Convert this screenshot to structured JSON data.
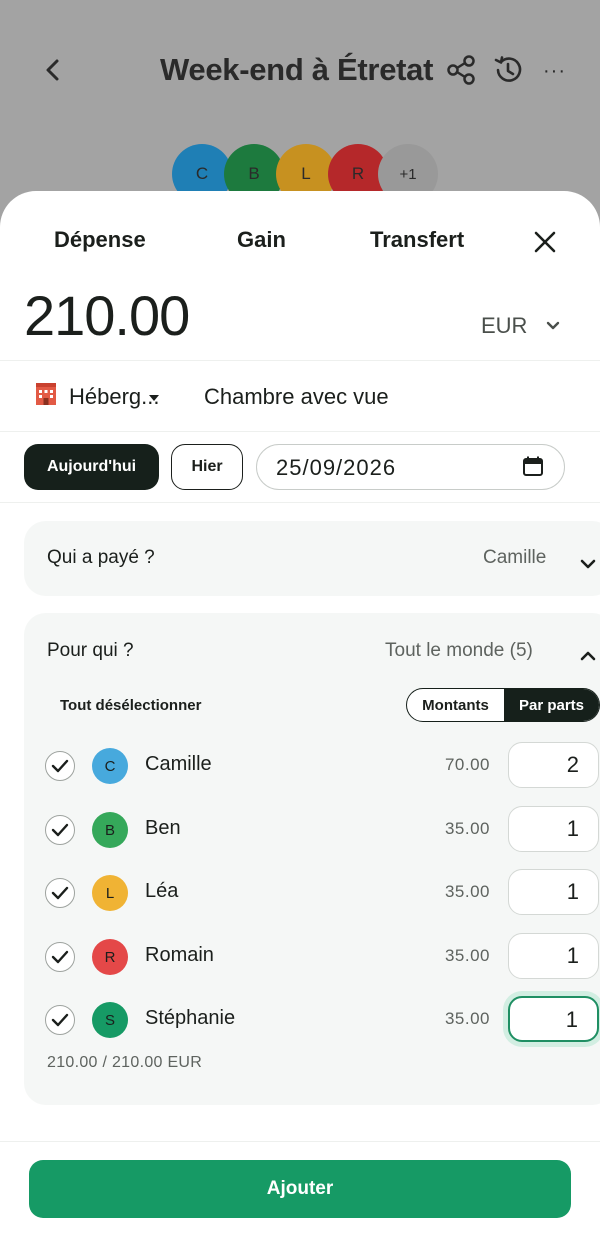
{
  "header": {
    "title": "Week-end à Étretat",
    "more_label": "···",
    "avatars": [
      {
        "initial": "C",
        "color": "#1f7fb5"
      },
      {
        "initial": "B",
        "color": "#1d7a3e"
      },
      {
        "initial": "L",
        "color": "#c79120"
      },
      {
        "initial": "R",
        "color": "#b5282a"
      }
    ],
    "extra_count": "+1"
  },
  "tabs": [
    {
      "label": "Dépense"
    },
    {
      "label": "Gain"
    },
    {
      "label": "Transfert"
    }
  ],
  "amount": "210.00",
  "currency": "EUR",
  "category": {
    "icon": "hotel-icon",
    "label": "Hébergement"
  },
  "category_display": "Héberg...",
  "description": "Chambre avec vue",
  "date": {
    "today_label": "Aujourd'hui",
    "yesterday_label": "Hier",
    "value": "25/09/2026"
  },
  "payer": {
    "label": "Qui a payé ?",
    "value": "Camille"
  },
  "split": {
    "label": "Pour qui ?",
    "value": "Tout le monde (5)",
    "deselect_label": "Tout désélectionner",
    "mode_amounts_label": "Montants",
    "mode_shares_label": "Par parts",
    "active_mode": "Par parts",
    "participants": [
      {
        "initial": "C",
        "name": "Camille",
        "color": "#47a9dd",
        "amount": "70.00",
        "shares": "2",
        "checked": true
      },
      {
        "initial": "B",
        "name": "Ben",
        "color": "#35a85a",
        "amount": "35.00",
        "shares": "1",
        "checked": true
      },
      {
        "initial": "L",
        "name": "Léa",
        "color": "#f0b334",
        "amount": "35.00",
        "shares": "1",
        "checked": true
      },
      {
        "initial": "R",
        "name": "Romain",
        "color": "#e44848",
        "amount": "35.00",
        "shares": "1",
        "checked": true
      },
      {
        "initial": "S",
        "name": "Stéphanie",
        "color": "#169a65",
        "amount": "35.00",
        "shares": "1",
        "checked": true
      }
    ],
    "total": "210.00 / 210.00 EUR"
  },
  "submit_label": "Ajouter",
  "colors": {
    "primary": "#169a65",
    "dark": "#16201b",
    "card_bg": "#f5f7f6",
    "overlay": "#a3a3a3"
  }
}
